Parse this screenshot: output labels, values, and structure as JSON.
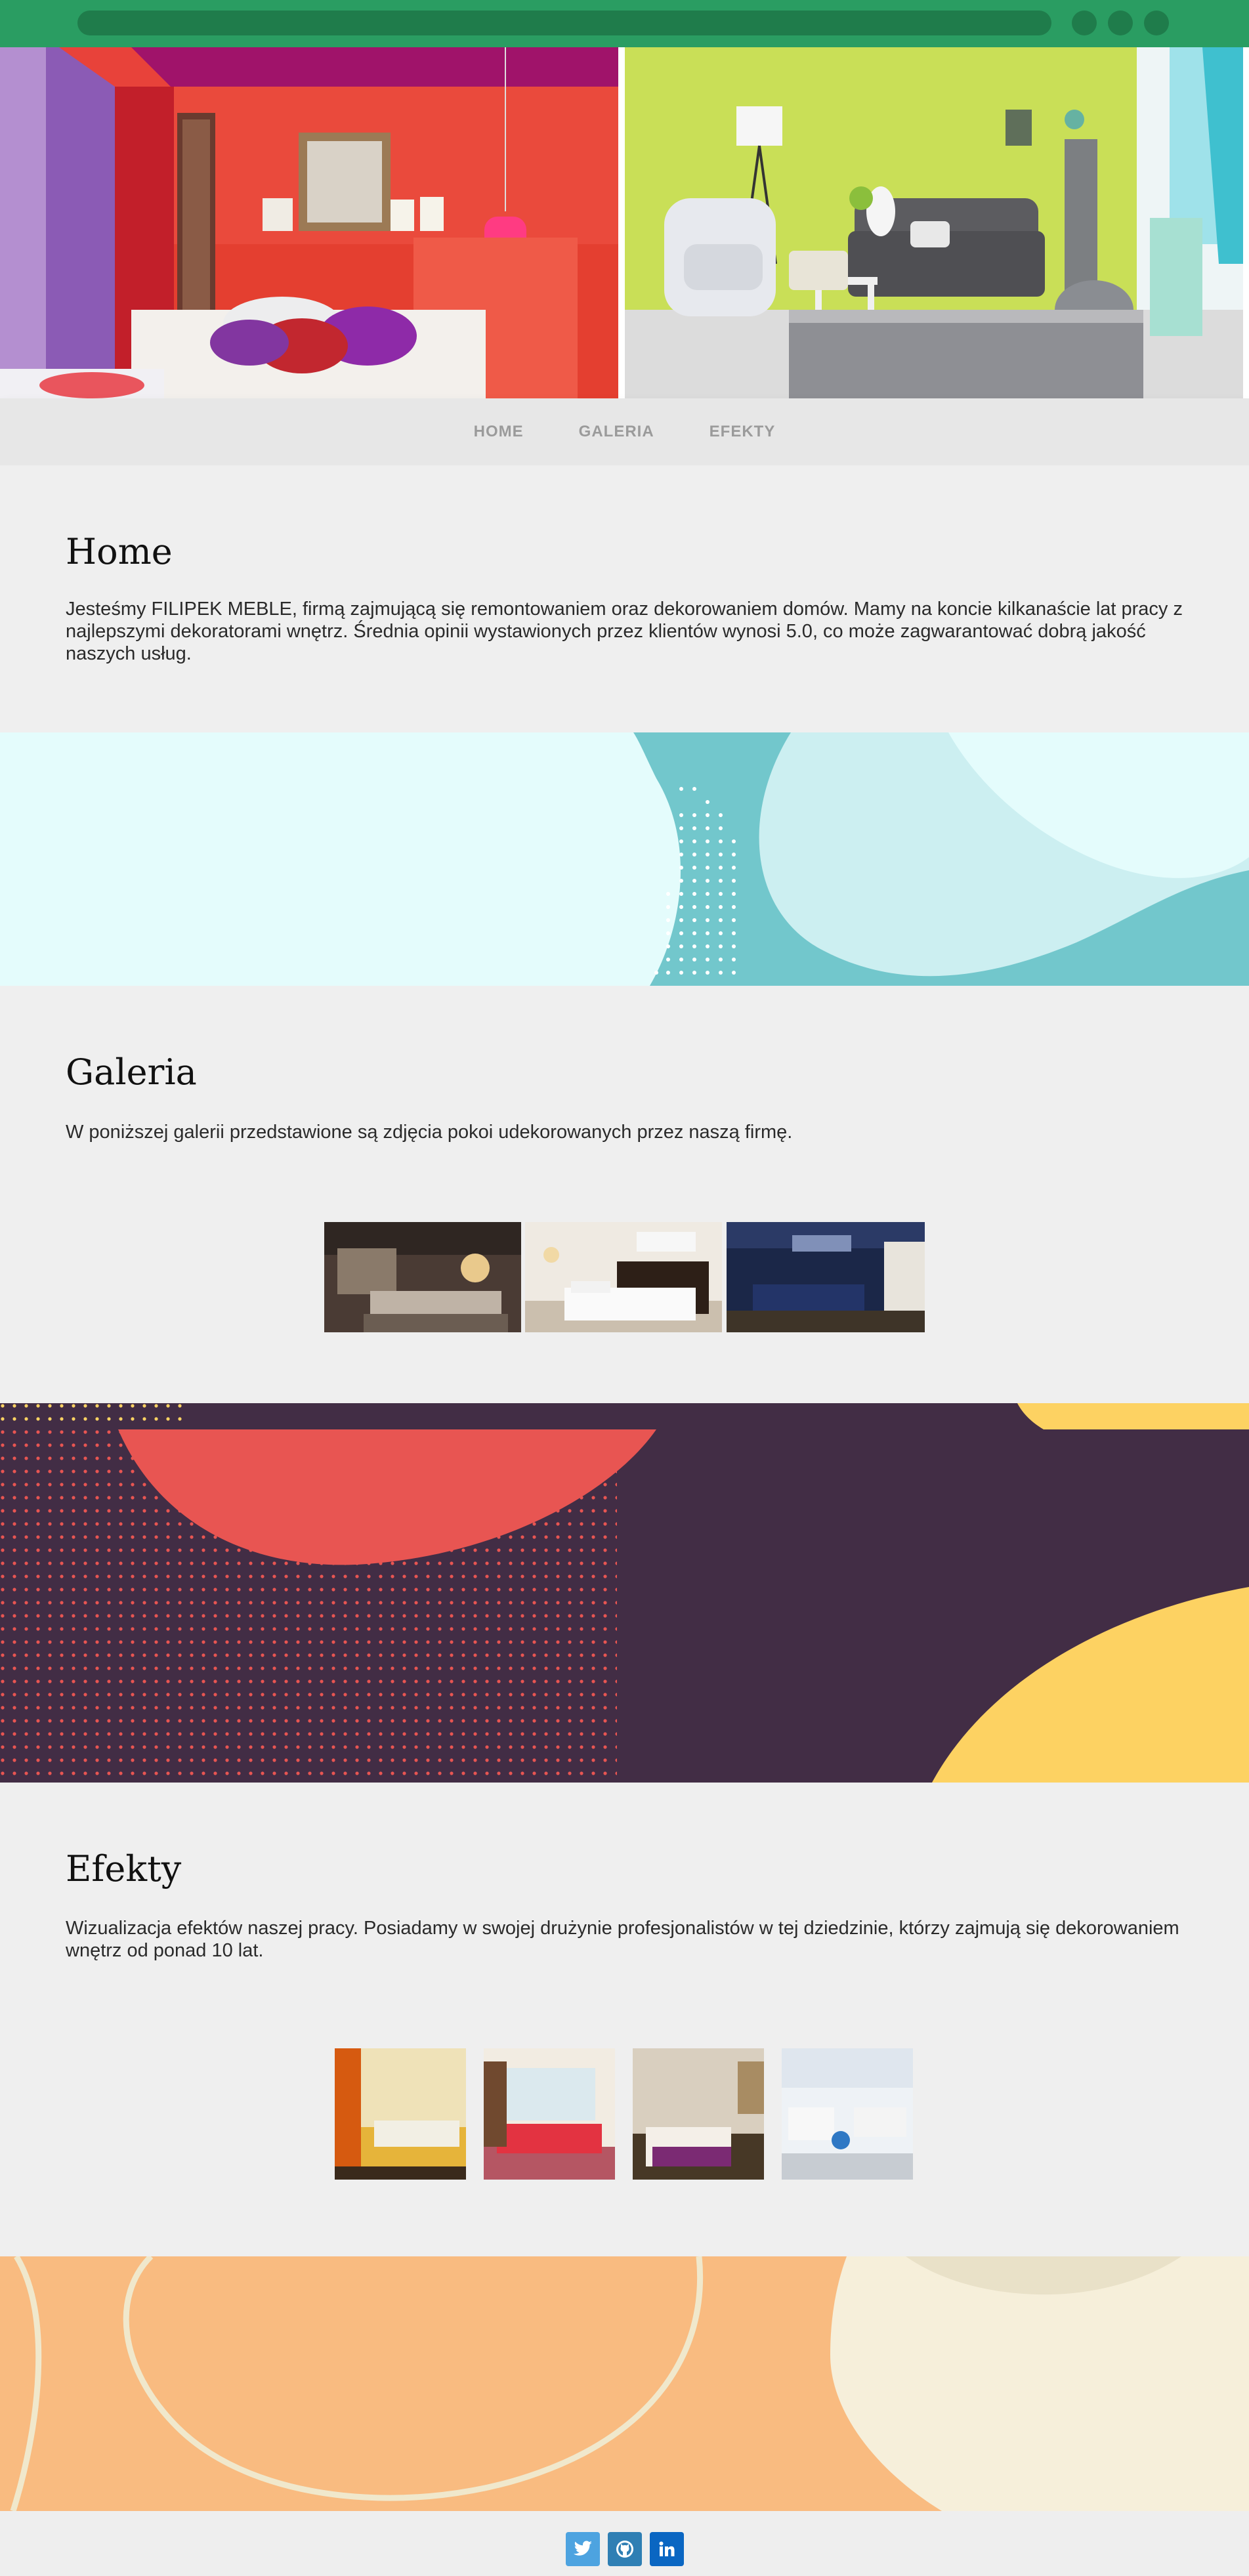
{
  "nav": {
    "items": [
      {
        "label": "HOME"
      },
      {
        "label": "GALERIA"
      },
      {
        "label": "EFEKTY"
      }
    ]
  },
  "home": {
    "title": "Home",
    "text": "Jesteśmy FILIPEK MEBLE, firmą zajmującą się remontowaniem oraz dekorowaniem domów. Mamy na koncie kilkanaście lat pracy z najlepszymi dekoratorami wnętrz. Średnia opinii wystawionych przez klientów wynosi 5.0, co może zagwarantować dobrą jakość naszych usług."
  },
  "galeria": {
    "title": "Galeria",
    "text": "W poniższej galerii przedstawione są zdjęcia pokoi udekorowanych przez naszą firmę."
  },
  "efekty": {
    "title": "Efekty",
    "text": "Wizualizacja efektów naszej pracy. Posiadamy w swojej drużynie profesjonalistów w tej dziedzinie, którzy zajmują się dekorowaniem wnętrz od ponad 10 lat."
  },
  "footer": {
    "social": [
      {
        "icon": "twitter-icon",
        "color": "#4da3e0"
      },
      {
        "icon": "github-icon",
        "color": "#2f7fb4"
      },
      {
        "icon": "linkedin-icon",
        "color": "#0a66c2"
      }
    ]
  },
  "colors": {
    "topbar": "#2a9d62",
    "divider_teal": "#72c7cc",
    "divider_plum": "#422d45",
    "divider_coral": "#e85552",
    "divider_yellow": "#fdd262",
    "divider_peach": "#f9bb80",
    "divider_cream": "#f6efda"
  }
}
